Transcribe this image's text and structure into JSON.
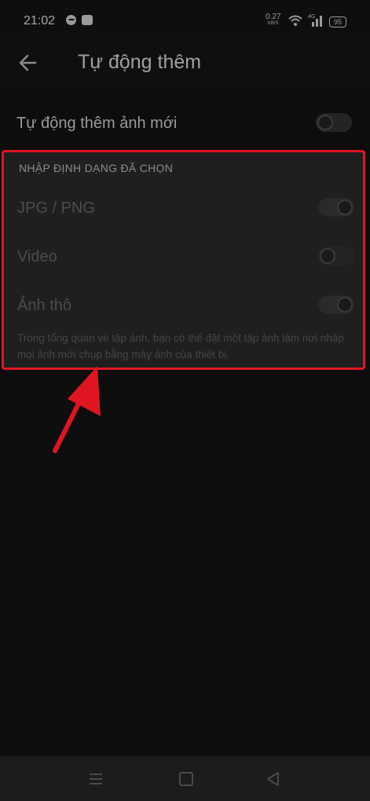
{
  "status_bar": {
    "time": "21:02",
    "net_speed": "0.27",
    "net_speed_unit": "KB/S",
    "network_type": "4G",
    "battery": "95",
    "icons": [
      "messenger-icon",
      "app-notification-icon",
      "wifi-icon",
      "signal-icon",
      "battery-icon"
    ]
  },
  "app_bar": {
    "back_icon": "arrow-left-icon",
    "title": "Tự động thêm"
  },
  "settings": {
    "auto_add_label": "Tự động thêm ảnh mới",
    "auto_add_on": false,
    "section_header": "NHẬP ĐỊNH DẠNG ĐÃ CHỌN",
    "options": [
      {
        "label": "JPG / PNG",
        "on": true
      },
      {
        "label": "Video",
        "on": false
      },
      {
        "label": "Ảnh thô",
        "on": true
      }
    ],
    "note": "Trong tổng quan về tập ảnh, bạn có thể đặt một tập ảnh làm nơi nhập mọi ảnh mới chụp bằng máy ảnh của thiết bị."
  },
  "annotation": {
    "highlight_color": "#e01522",
    "arrow_color": "#e01522"
  },
  "nav_bar": {
    "icons": [
      "menu-icon",
      "home-icon",
      "back-triangle-icon"
    ]
  }
}
